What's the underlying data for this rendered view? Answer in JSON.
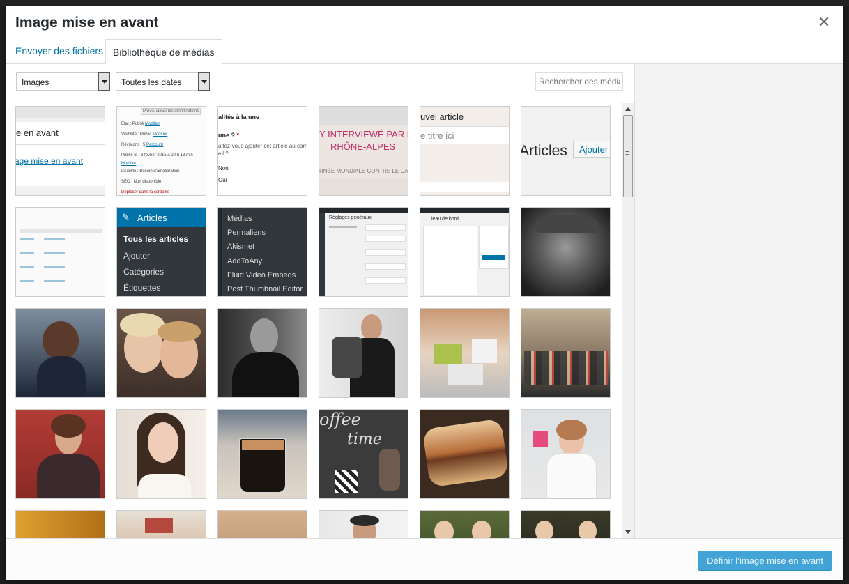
{
  "modal": {
    "title": "Image mise en avant",
    "close_icon": "close-icon"
  },
  "tabs": [
    {
      "label": "Envoyer des fichiers"
    },
    {
      "label": "Bibliothèque de médias"
    }
  ],
  "filters": {
    "type_selected": "Images",
    "date_selected": "Toutes les dates",
    "search_placeholder": "Rechercher des média"
  },
  "thumbs": {
    "t1": {
      "line1": "e en avant",
      "link": "age mise en avant"
    },
    "t2": {
      "tooltip": "Prévisualiser les modifications",
      "state_prefix": "État : Publié",
      "state_link": "Modifier",
      "vis_prefix": "Visibilité : Public",
      "vis_link": "Modifier",
      "rev_prefix": "Révisions : 5",
      "rev_link": "Parcourir",
      "pub_line1": "Publié le : 8 février 2015 à 20 h 13 min",
      "pub_link": "Modifier",
      "lisib": "Lisibilité : Besoin d'amélioration",
      "seo": "SEO : Non disponible",
      "trash": "Déplacer dans la corbeille"
    },
    "t3": {
      "line1": "alités à la une",
      "question": "une ?",
      "asterisk": "*",
      "desc1": "aitez-vous ajouter cet article au carrous",
      "desc2": "eil ?",
      "opt_no": "Non",
      "opt_yes": "Oui"
    },
    "t4": {
      "line1": "Y INTERVIEWÉ PAR F",
      "line2": "RHÔNE-ALPES",
      "line3": "RNÉE MONDIALE CONTRE LE CAN"
    },
    "t5": {
      "line1": "uvel article",
      "line2": "e titre ici"
    },
    "t6": {
      "label": "Articles",
      "button": "Ajouter"
    },
    "t8": {
      "header": "Articles",
      "items": [
        "Tous les articles",
        "Ajouter",
        "Catégories",
        "Étiquettes"
      ]
    },
    "t9": {
      "items": [
        "Médias",
        "Permaliens",
        "Akismet",
        "AddToAny",
        "Fluid Video Embeds",
        "Post Thumbnail Editor"
      ]
    },
    "t10": {
      "title": "Réglages généraux"
    },
    "t11": {
      "title": "leau de bord"
    },
    "t22": {
      "text1": "offee",
      "text2": "time"
    }
  },
  "footer": {
    "button_label": "Définir l’image mise en avant"
  },
  "colors": {
    "accent": "#0073aa",
    "primary_button": "#42a4d6",
    "admin_menu": "#32373c",
    "admin_active": "#0073aa"
  }
}
